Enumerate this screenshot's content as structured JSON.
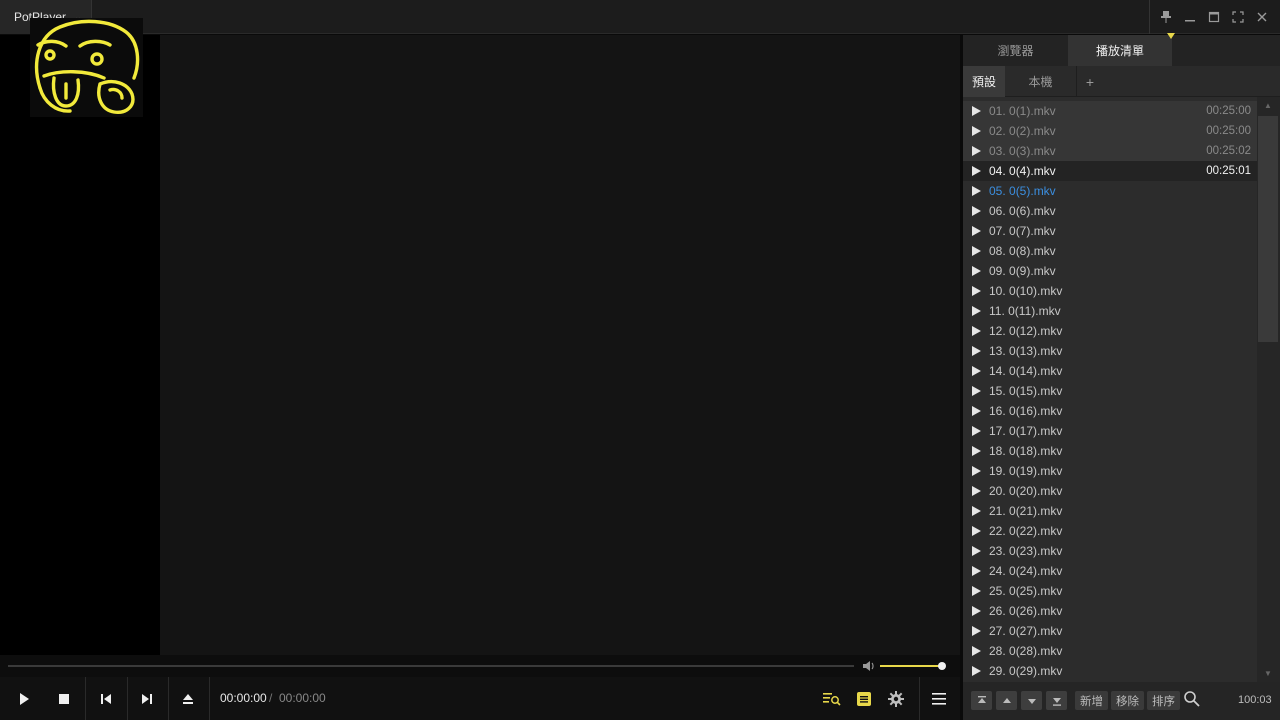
{
  "window": {
    "app_title": "PotPlayer",
    "chevron": "⌄",
    "buttons": [
      "pin-icon",
      "minimize-icon",
      "maximize-icon",
      "fullscreen-icon",
      "close-icon"
    ]
  },
  "colors": {
    "accent_yellow": "#e8d84a",
    "next_item_blue": "#3c8fe0",
    "panel_bg": "#2c2c2c",
    "video_bg": "#141414"
  },
  "player": {
    "time_current": "00:00:00",
    "time_separator": "/",
    "time_total": "00:00:00",
    "seek_progress": 0,
    "volume": 1.0
  },
  "panel": {
    "tabs": [
      {
        "label": "瀏覽器",
        "active": false
      },
      {
        "label": "播放清單",
        "active": true
      }
    ],
    "subtabs": [
      {
        "label": "預設",
        "active": true
      },
      {
        "label": "本機",
        "active": false
      },
      {
        "label": "+",
        "active": false
      }
    ],
    "items": [
      {
        "label": "01. 0(1).mkv",
        "duration": "00:25:00",
        "state": "played"
      },
      {
        "label": "02. 0(2).mkv",
        "duration": "00:25:00",
        "state": "played"
      },
      {
        "label": "03. 0(3).mkv",
        "duration": "00:25:02",
        "state": "played"
      },
      {
        "label": "04. 0(4).mkv",
        "duration": "00:25:01",
        "state": "current"
      },
      {
        "label": "05. 0(5).mkv",
        "duration": "",
        "state": "next"
      },
      {
        "label": "06. 0(6).mkv",
        "duration": "",
        "state": "normal"
      },
      {
        "label": "07. 0(7).mkv",
        "duration": "",
        "state": "normal"
      },
      {
        "label": "08. 0(8).mkv",
        "duration": "",
        "state": "normal"
      },
      {
        "label": "09. 0(9).mkv",
        "duration": "",
        "state": "normal"
      },
      {
        "label": "10. 0(10).mkv",
        "duration": "",
        "state": "normal"
      },
      {
        "label": "11. 0(11).mkv",
        "duration": "",
        "state": "normal"
      },
      {
        "label": "12. 0(12).mkv",
        "duration": "",
        "state": "normal"
      },
      {
        "label": "13. 0(13).mkv",
        "duration": "",
        "state": "normal"
      },
      {
        "label": "14. 0(14).mkv",
        "duration": "",
        "state": "normal"
      },
      {
        "label": "15. 0(15).mkv",
        "duration": "",
        "state": "normal"
      },
      {
        "label": "16. 0(16).mkv",
        "duration": "",
        "state": "normal"
      },
      {
        "label": "17. 0(17).mkv",
        "duration": "",
        "state": "normal"
      },
      {
        "label": "18. 0(18).mkv",
        "duration": "",
        "state": "normal"
      },
      {
        "label": "19. 0(19).mkv",
        "duration": "",
        "state": "normal"
      },
      {
        "label": "20. 0(20).mkv",
        "duration": "",
        "state": "normal"
      },
      {
        "label": "21. 0(21).mkv",
        "duration": "",
        "state": "normal"
      },
      {
        "label": "22. 0(22).mkv",
        "duration": "",
        "state": "normal"
      },
      {
        "label": "23. 0(23).mkv",
        "duration": "",
        "state": "normal"
      },
      {
        "label": "24. 0(24).mkv",
        "duration": "",
        "state": "normal"
      },
      {
        "label": "25. 0(25).mkv",
        "duration": "",
        "state": "normal"
      },
      {
        "label": "26. 0(26).mkv",
        "duration": "",
        "state": "normal"
      },
      {
        "label": "27. 0(27).mkv",
        "duration": "",
        "state": "normal"
      },
      {
        "label": "28. 0(28).mkv",
        "duration": "",
        "state": "normal"
      },
      {
        "label": "29. 0(29).mkv",
        "duration": "",
        "state": "normal"
      }
    ],
    "footer": {
      "add_label": "新增",
      "remove_label": "移除",
      "sort_label": "排序",
      "count": "100:03"
    }
  }
}
